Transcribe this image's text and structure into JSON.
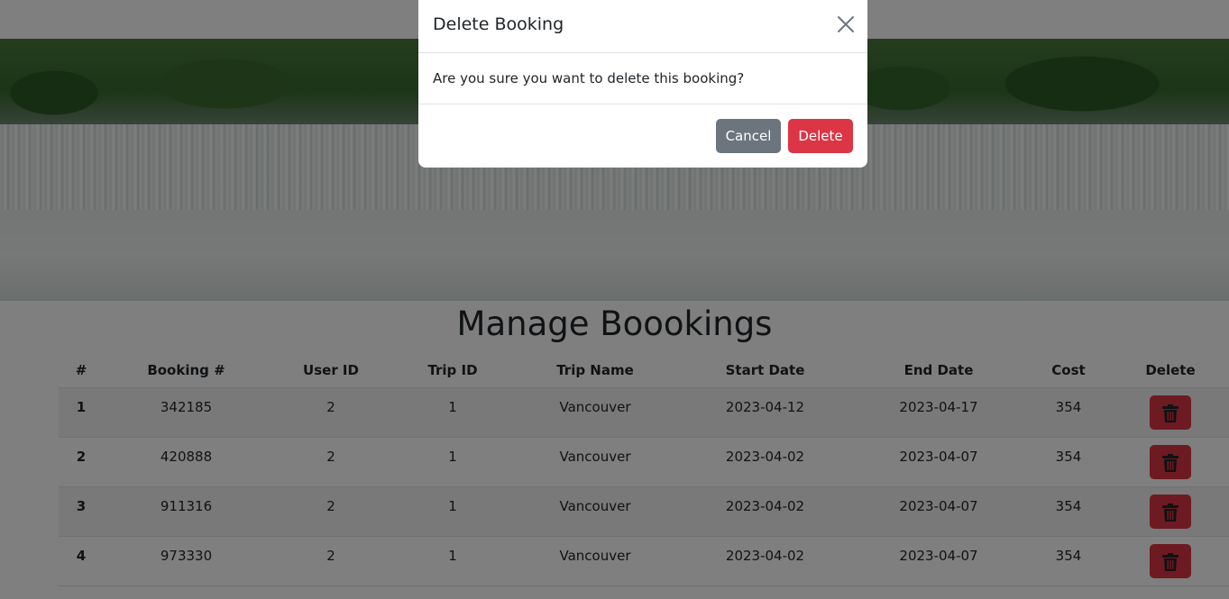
{
  "modal": {
    "title": "Delete Booking",
    "message": "Are you sure you want to delete this booking?",
    "cancel_label": "Cancel",
    "delete_label": "Delete"
  },
  "page": {
    "title": "Manage Boookings"
  },
  "table": {
    "headers": [
      "#",
      "Booking #",
      "User ID",
      "Trip ID",
      "Trip Name",
      "Start Date",
      "End Date",
      "Cost",
      "Delete"
    ],
    "rows": [
      {
        "num": "1",
        "booking": "342185",
        "user_id": "2",
        "trip_id": "1",
        "trip_name": "Vancouver",
        "start": "2023-04-12",
        "end": "2023-04-17",
        "cost": "354"
      },
      {
        "num": "2",
        "booking": "420888",
        "user_id": "2",
        "trip_id": "1",
        "trip_name": "Vancouver",
        "start": "2023-04-02",
        "end": "2023-04-07",
        "cost": "354"
      },
      {
        "num": "3",
        "booking": "911316",
        "user_id": "2",
        "trip_id": "1",
        "trip_name": "Vancouver",
        "start": "2023-04-02",
        "end": "2023-04-07",
        "cost": "354"
      },
      {
        "num": "4",
        "booking": "973330",
        "user_id": "2",
        "trip_id": "1",
        "trip_name": "Vancouver",
        "start": "2023-04-02",
        "end": "2023-04-07",
        "cost": "354"
      }
    ]
  },
  "icons": {
    "close": "close-icon",
    "trash": "trash-icon"
  },
  "colors": {
    "danger": "#dc3545",
    "secondary": "#6c757d"
  }
}
